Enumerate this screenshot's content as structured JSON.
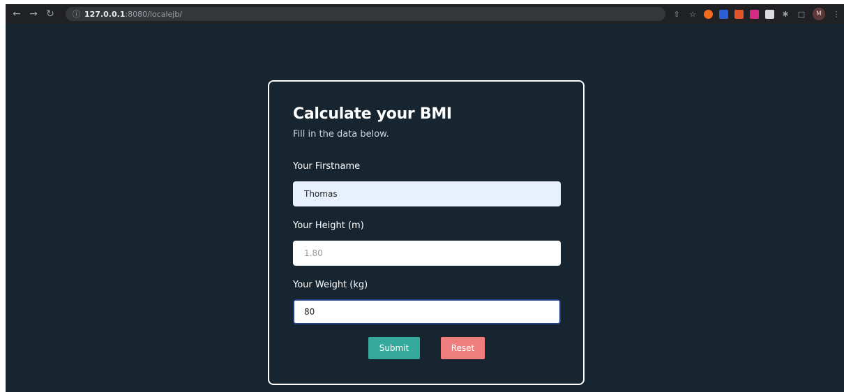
{
  "browser": {
    "url_host": "127.0.0.1",
    "url_path": ":8080/localejb/",
    "avatar_initial": "M"
  },
  "form": {
    "title": "Calculate your BMI",
    "subtitle": "Fill in the data below.",
    "firstname_label": "Your Firstname",
    "firstname_value": "Thomas",
    "height_label": "Your Height (m)",
    "height_placeholder": "1.80",
    "weight_label": "Your Weight (kg)",
    "weight_value": "80",
    "submit_label": "Submit",
    "reset_label": "Reset"
  },
  "colors": {
    "background": "#16252f",
    "submit": "#35a99c",
    "reset": "#ef7e7e"
  }
}
